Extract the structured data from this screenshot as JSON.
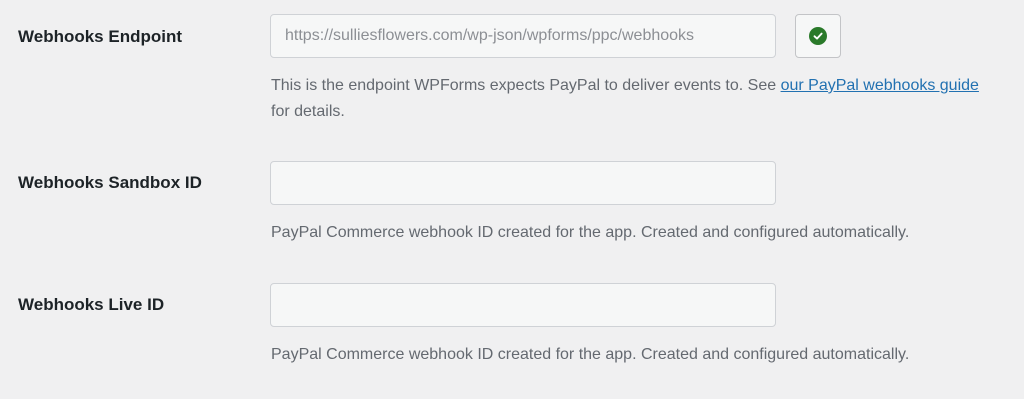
{
  "endpoint": {
    "label": "Webhooks Endpoint",
    "value": "https://sulliesflowers.com/wp-json/wpforms/ppc/webhooks",
    "status_icon": "check-circle-icon",
    "status_color": "#2a7a2a",
    "desc_before": "This is the endpoint WPForms expects PayPal to deliver events to. See ",
    "link_text": "our PayPal webhooks guide",
    "desc_after": " for details."
  },
  "sandbox": {
    "label": "Webhooks Sandbox ID",
    "value": "",
    "desc": "PayPal Commerce webhook ID created for the app. Created and configured automatically."
  },
  "live": {
    "label": "Webhooks Live ID",
    "value": "",
    "desc": "PayPal Commerce webhook ID created for the app. Created and configured automatically."
  },
  "colors": {
    "background": "#f0f0f1",
    "link": "#2271b1",
    "success": "#2a7a2a"
  }
}
